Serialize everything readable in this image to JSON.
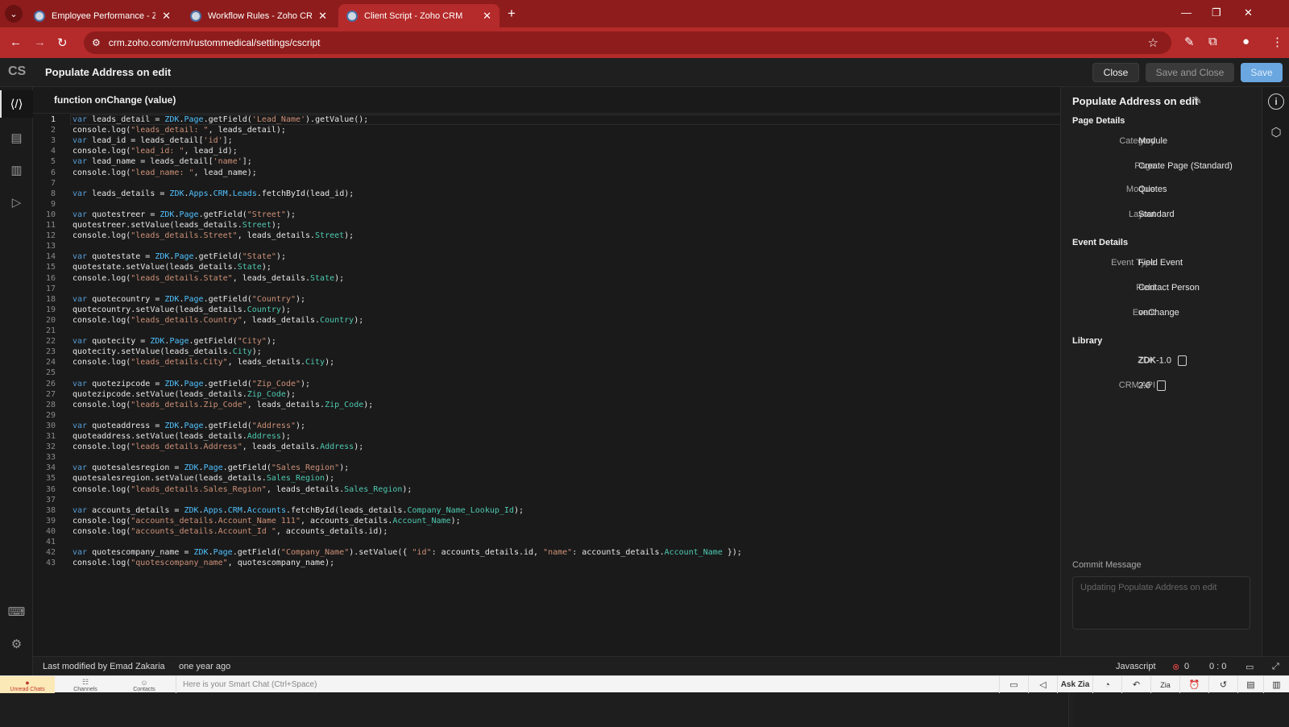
{
  "browser": {
    "tabs": [
      {
        "title": "Employee Performance - Zoho",
        "active": false
      },
      {
        "title": "Workflow Rules - Zoho CRM",
        "active": false
      },
      {
        "title": "Client Script - Zoho CRM",
        "active": true
      }
    ],
    "url": "crm.zoho.com/crm/rustommedical/settings/cscript",
    "colors": {
      "tabbar": "#8e1c1c",
      "toolbar": "#b52a2a"
    }
  },
  "header": {
    "logo": "CS",
    "title": "Populate Address on edit",
    "close_label": "Close",
    "save_close_label": "Save and Close",
    "save_label": "Save"
  },
  "editor": {
    "function_signature": "function onChange (value)",
    "lines": [
      [
        [
          "kw",
          "var"
        ],
        [
          "t",
          " leads_detail = "
        ],
        [
          "obj",
          "ZDK"
        ],
        [
          "t",
          "."
        ],
        [
          "obj",
          "Page"
        ],
        [
          "t",
          ".getField("
        ],
        [
          "str",
          "'Lead_Name'"
        ],
        [
          "t",
          ").getValue();"
        ]
      ],
      [
        [
          "t",
          "console.log("
        ],
        [
          "str",
          "\"leads_detail: \""
        ],
        [
          "t",
          ", leads_detail);"
        ]
      ],
      [
        [
          "kw",
          "var"
        ],
        [
          "t",
          " lead_id = leads_detail["
        ],
        [
          "str",
          "'id'"
        ],
        [
          "t",
          "];"
        ]
      ],
      [
        [
          "t",
          "console.log("
        ],
        [
          "str",
          "\"lead_id: \""
        ],
        [
          "t",
          ", lead_id);"
        ]
      ],
      [
        [
          "kw",
          "var"
        ],
        [
          "t",
          " lead_name = leads_detail["
        ],
        [
          "str",
          "'name'"
        ],
        [
          "t",
          "];"
        ]
      ],
      [
        [
          "t",
          "console.log("
        ],
        [
          "str",
          "\"lead_name: \""
        ],
        [
          "t",
          ", lead_name);"
        ]
      ],
      [],
      [
        [
          "kw",
          "var"
        ],
        [
          "t",
          " leads_details = "
        ],
        [
          "obj",
          "ZDK"
        ],
        [
          "t",
          "."
        ],
        [
          "obj",
          "Apps"
        ],
        [
          "t",
          "."
        ],
        [
          "obj",
          "CRM"
        ],
        [
          "t",
          "."
        ],
        [
          "obj",
          "Leads"
        ],
        [
          "t",
          ".fetchById(lead_id);"
        ]
      ],
      [],
      [
        [
          "kw",
          "var"
        ],
        [
          "t",
          " quotestreer = "
        ],
        [
          "obj",
          "ZDK"
        ],
        [
          "t",
          "."
        ],
        [
          "obj",
          "Page"
        ],
        [
          "t",
          ".getField("
        ],
        [
          "str",
          "\"Street\""
        ],
        [
          "t",
          ");"
        ]
      ],
      [
        [
          "t",
          "quotestreer.setValue(leads_details."
        ],
        [
          "prop",
          "Street"
        ],
        [
          "t",
          ");"
        ]
      ],
      [
        [
          "t",
          "console.log("
        ],
        [
          "str",
          "\"leads_details.Street\""
        ],
        [
          "t",
          ", leads_details."
        ],
        [
          "prop",
          "Street"
        ],
        [
          "t",
          ");"
        ]
      ],
      [],
      [
        [
          "kw",
          "var"
        ],
        [
          "t",
          " quotestate = "
        ],
        [
          "obj",
          "ZDK"
        ],
        [
          "t",
          "."
        ],
        [
          "obj",
          "Page"
        ],
        [
          "t",
          ".getField("
        ],
        [
          "str",
          "\"State\""
        ],
        [
          "t",
          ");"
        ]
      ],
      [
        [
          "t",
          "quotestate.setValue(leads_details."
        ],
        [
          "prop",
          "State"
        ],
        [
          "t",
          ");"
        ]
      ],
      [
        [
          "t",
          "console.log("
        ],
        [
          "str",
          "\"leads_details.State\""
        ],
        [
          "t",
          ", leads_details."
        ],
        [
          "prop",
          "State"
        ],
        [
          "t",
          ");"
        ]
      ],
      [],
      [
        [
          "kw",
          "var"
        ],
        [
          "t",
          " quotecountry = "
        ],
        [
          "obj",
          "ZDK"
        ],
        [
          "t",
          "."
        ],
        [
          "obj",
          "Page"
        ],
        [
          "t",
          ".getField("
        ],
        [
          "str",
          "\"Country\""
        ],
        [
          "t",
          ");"
        ]
      ],
      [
        [
          "t",
          "quotecountry.setValue(leads_details."
        ],
        [
          "prop",
          "Country"
        ],
        [
          "t",
          ");"
        ]
      ],
      [
        [
          "t",
          "console.log("
        ],
        [
          "str",
          "\"leads_details.Country\""
        ],
        [
          "t",
          ", leads_details."
        ],
        [
          "prop",
          "Country"
        ],
        [
          "t",
          ");"
        ]
      ],
      [],
      [
        [
          "kw",
          "var"
        ],
        [
          "t",
          " quotecity = "
        ],
        [
          "obj",
          "ZDK"
        ],
        [
          "t",
          "."
        ],
        [
          "obj",
          "Page"
        ],
        [
          "t",
          ".getField("
        ],
        [
          "str",
          "\"City\""
        ],
        [
          "t",
          ");"
        ]
      ],
      [
        [
          "t",
          "quotecity.setValue(leads_details."
        ],
        [
          "prop",
          "City"
        ],
        [
          "t",
          ");"
        ]
      ],
      [
        [
          "t",
          "console.log("
        ],
        [
          "str",
          "\"leads_details.City\""
        ],
        [
          "t",
          ", leads_details."
        ],
        [
          "prop",
          "City"
        ],
        [
          "t",
          ");"
        ]
      ],
      [],
      [
        [
          "kw",
          "var"
        ],
        [
          "t",
          " quotezipcode = "
        ],
        [
          "obj",
          "ZDK"
        ],
        [
          "t",
          "."
        ],
        [
          "obj",
          "Page"
        ],
        [
          "t",
          ".getField("
        ],
        [
          "str",
          "\"Zip_Code\""
        ],
        [
          "t",
          ");"
        ]
      ],
      [
        [
          "t",
          "quotezipcode.setValue(leads_details."
        ],
        [
          "prop",
          "Zip_Code"
        ],
        [
          "t",
          ");"
        ]
      ],
      [
        [
          "t",
          "console.log("
        ],
        [
          "str",
          "\"leads_details.Zip_Code\""
        ],
        [
          "t",
          ", leads_details."
        ],
        [
          "prop",
          "Zip_Code"
        ],
        [
          "t",
          ");"
        ]
      ],
      [],
      [
        [
          "kw",
          "var"
        ],
        [
          "t",
          " quoteaddress = "
        ],
        [
          "obj",
          "ZDK"
        ],
        [
          "t",
          "."
        ],
        [
          "obj",
          "Page"
        ],
        [
          "t",
          ".getField("
        ],
        [
          "str",
          "\"Address\""
        ],
        [
          "t",
          ");"
        ]
      ],
      [
        [
          "t",
          "quoteaddress.setValue(leads_details."
        ],
        [
          "prop",
          "Address"
        ],
        [
          "t",
          ");"
        ]
      ],
      [
        [
          "t",
          "console.log("
        ],
        [
          "str",
          "\"leads_details.Address\""
        ],
        [
          "t",
          ", leads_details."
        ],
        [
          "prop",
          "Address"
        ],
        [
          "t",
          ");"
        ]
      ],
      [],
      [
        [
          "kw",
          "var"
        ],
        [
          "t",
          " quotesalesregion = "
        ],
        [
          "obj",
          "ZDK"
        ],
        [
          "t",
          "."
        ],
        [
          "obj",
          "Page"
        ],
        [
          "t",
          ".getField("
        ],
        [
          "str",
          "\"Sales_Region\""
        ],
        [
          "t",
          ");"
        ]
      ],
      [
        [
          "t",
          "quotesalesregion.setValue(leads_details."
        ],
        [
          "prop",
          "Sales_Region"
        ],
        [
          "t",
          ");"
        ]
      ],
      [
        [
          "t",
          "console.log("
        ],
        [
          "str",
          "\"leads_details.Sales_Region\""
        ],
        [
          "t",
          ", leads_details."
        ],
        [
          "prop",
          "Sales_Region"
        ],
        [
          "t",
          ");"
        ]
      ],
      [],
      [
        [
          "kw",
          "var"
        ],
        [
          "t",
          " accounts_details = "
        ],
        [
          "obj",
          "ZDK"
        ],
        [
          "t",
          "."
        ],
        [
          "obj",
          "Apps"
        ],
        [
          "t",
          "."
        ],
        [
          "obj",
          "CRM"
        ],
        [
          "t",
          "."
        ],
        [
          "obj",
          "Accounts"
        ],
        [
          "t",
          ".fetchById(leads_details."
        ],
        [
          "prop",
          "Company_Name_Lookup_Id"
        ],
        [
          "t",
          ");"
        ]
      ],
      [
        [
          "t",
          "console.log("
        ],
        [
          "str",
          "\"accounts_details.Account_Name 111\""
        ],
        [
          "t",
          ", accounts_details."
        ],
        [
          "prop",
          "Account_Name"
        ],
        [
          "t",
          ");"
        ]
      ],
      [
        [
          "t",
          "console.log("
        ],
        [
          "str",
          "\"accounts_details.Account_Id \""
        ],
        [
          "t",
          ", accounts_details.id);"
        ]
      ],
      [],
      [
        [
          "kw",
          "var"
        ],
        [
          "t",
          " quotescompany_name = "
        ],
        [
          "obj",
          "ZDK"
        ],
        [
          "t",
          "."
        ],
        [
          "obj",
          "Page"
        ],
        [
          "t",
          ".getField("
        ],
        [
          "str",
          "\"Company_Name\""
        ],
        [
          "t",
          ").setValue({ "
        ],
        [
          "str",
          "\"id\""
        ],
        [
          "t",
          ": accounts_details.id, "
        ],
        [
          "str",
          "\"name\""
        ],
        [
          "t",
          ": accounts_details."
        ],
        [
          "prop",
          "Account_Name"
        ],
        [
          "t",
          " });"
        ]
      ],
      [
        [
          "t",
          "console.log("
        ],
        [
          "str",
          "\"quotescompany_name\""
        ],
        [
          "t",
          ", quotescompany_name);"
        ]
      ]
    ]
  },
  "details": {
    "title": "Populate Address on edit",
    "page_details_heading": "Page Details",
    "page_details": [
      {
        "key": "Category",
        "value": "Module"
      },
      {
        "key": "Page",
        "value": "Create Page (Standard)"
      },
      {
        "key": "Module",
        "value": "Quotes"
      },
      {
        "key": "Layout",
        "value": "Standard"
      }
    ],
    "event_details_heading": "Event Details",
    "event_details": [
      {
        "key": "Event Type",
        "value": "Field Event"
      },
      {
        "key": "Field",
        "value": "Contact Person"
      },
      {
        "key": "Event",
        "value": "onChange"
      }
    ],
    "library_heading": "Library",
    "library": [
      {
        "key": "ZDK",
        "value": "ZDK-1.0"
      },
      {
        "key": "CRM API",
        "value": "2.0"
      }
    ],
    "commit_label": "Commit Message",
    "commit_placeholder": "Updating Populate Address on edit"
  },
  "status": {
    "modified_by": "Last modified by Emad Zakaria",
    "modified_when": "one year ago",
    "language": "Javascript",
    "errors": "0",
    "position": "0 : 0"
  },
  "chatbar": {
    "unread_label": "Unread Chats",
    "channels_label": "Channels",
    "contacts_label": "Contacts",
    "input_placeholder": "Here is your Smart Chat (Ctrl+Space)",
    "ask_zia": "Ask Zia"
  }
}
